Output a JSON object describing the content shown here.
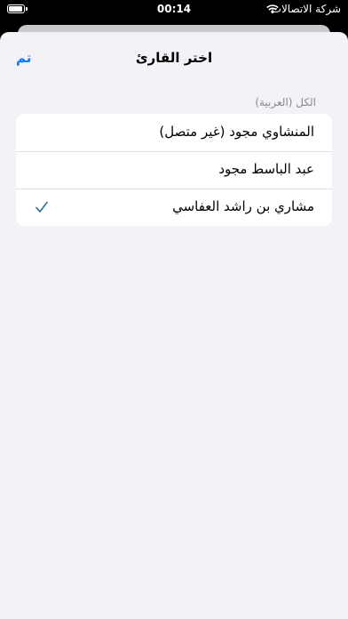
{
  "status_bar": {
    "carrier": "شركة الاتصالات",
    "time": "00:14"
  },
  "sheet": {
    "title": "اختر القارئ",
    "done_label": "تم",
    "section_header": "الكل (العربية)",
    "reciters": [
      {
        "label": "المنشاوي مجود (غير متصل)",
        "selected": false
      },
      {
        "label": "عبد الباسط مجود",
        "selected": false
      },
      {
        "label": "مشاري بن راشد العفاسي",
        "selected": true
      }
    ]
  },
  "colors": {
    "accent": "#0a7aff",
    "background": "#f2f2f7",
    "checkmark": "#2e6b8a"
  },
  "icons": {
    "wifi": "wifi-icon",
    "battery": "battery-icon",
    "selected": "checkmark-icon"
  }
}
